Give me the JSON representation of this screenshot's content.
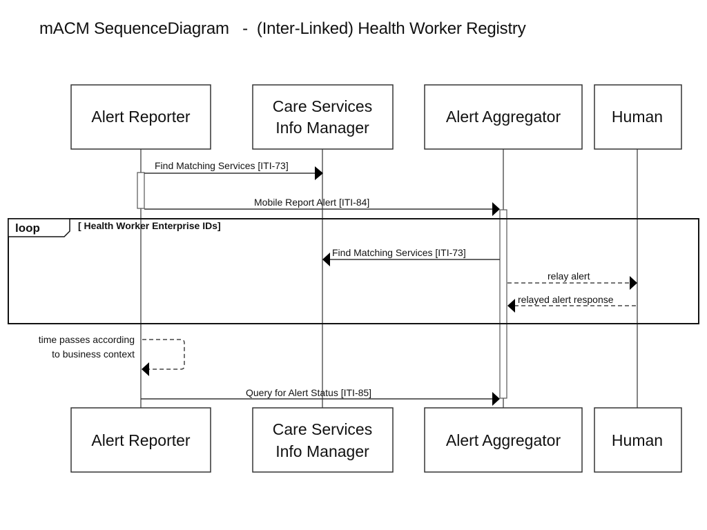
{
  "title": "mACM SequenceDiagram   -  (Inter-Linked) Health Worker Registry",
  "participants": [
    {
      "id": "alert-reporter",
      "lines": [
        "Alert Reporter"
      ]
    },
    {
      "id": "care-services-info-manager",
      "lines": [
        "Care Services",
        "Info Manager"
      ]
    },
    {
      "id": "alert-aggregator",
      "lines": [
        "Alert Aggregator"
      ]
    },
    {
      "id": "human",
      "lines": [
        "Human"
      ]
    }
  ],
  "messages": [
    {
      "from": "alert-reporter",
      "to": "care-services-info-manager",
      "label": "Find Matching Services [ITI-73]",
      "style": "solid"
    },
    {
      "from": "alert-reporter",
      "to": "alert-aggregator",
      "label": "Mobile Report Alert [ITI-84]",
      "style": "solid"
    },
    {
      "from": "alert-aggregator",
      "to": "care-services-info-manager",
      "label": "Find Matching Services [ITI-73]",
      "style": "solid"
    },
    {
      "from": "alert-aggregator",
      "to": "human",
      "label": "relay alert",
      "style": "dashed"
    },
    {
      "from": "human",
      "to": "alert-aggregator",
      "label": "relayed alert response",
      "style": "dashed"
    },
    {
      "from": "alert-reporter",
      "to": "alert-aggregator",
      "label": "Query for Alert Status [ITI-85]",
      "style": "solid"
    }
  ],
  "loop": {
    "operator": "loop",
    "guard": "[ Health Worker Enterprise IDs]"
  },
  "self_message": {
    "participant": "alert-reporter",
    "lines": [
      "time passes according",
      "to business context"
    ],
    "style": "dashed"
  }
}
